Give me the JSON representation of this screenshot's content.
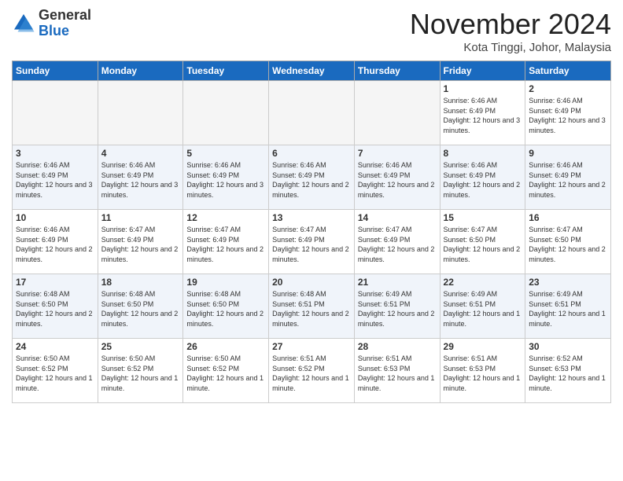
{
  "logo": {
    "general": "General",
    "blue": "Blue"
  },
  "header": {
    "month": "November 2024",
    "location": "Kota Tinggi, Johor, Malaysia"
  },
  "days_of_week": [
    "Sunday",
    "Monday",
    "Tuesday",
    "Wednesday",
    "Thursday",
    "Friday",
    "Saturday"
  ],
  "weeks": [
    [
      {
        "day": null
      },
      {
        "day": null
      },
      {
        "day": null
      },
      {
        "day": null
      },
      {
        "day": null
      },
      {
        "day": "1",
        "sunrise": "6:46 AM",
        "sunset": "6:49 PM",
        "daylight": "12 hours and 3 minutes."
      },
      {
        "day": "2",
        "sunrise": "6:46 AM",
        "sunset": "6:49 PM",
        "daylight": "12 hours and 3 minutes."
      }
    ],
    [
      {
        "day": "3",
        "sunrise": "6:46 AM",
        "sunset": "6:49 PM",
        "daylight": "12 hours and 3 minutes."
      },
      {
        "day": "4",
        "sunrise": "6:46 AM",
        "sunset": "6:49 PM",
        "daylight": "12 hours and 3 minutes."
      },
      {
        "day": "5",
        "sunrise": "6:46 AM",
        "sunset": "6:49 PM",
        "daylight": "12 hours and 3 minutes."
      },
      {
        "day": "6",
        "sunrise": "6:46 AM",
        "sunset": "6:49 PM",
        "daylight": "12 hours and 2 minutes."
      },
      {
        "day": "7",
        "sunrise": "6:46 AM",
        "sunset": "6:49 PM",
        "daylight": "12 hours and 2 minutes."
      },
      {
        "day": "8",
        "sunrise": "6:46 AM",
        "sunset": "6:49 PM",
        "daylight": "12 hours and 2 minutes."
      },
      {
        "day": "9",
        "sunrise": "6:46 AM",
        "sunset": "6:49 PM",
        "daylight": "12 hours and 2 minutes."
      }
    ],
    [
      {
        "day": "10",
        "sunrise": "6:46 AM",
        "sunset": "6:49 PM",
        "daylight": "12 hours and 2 minutes."
      },
      {
        "day": "11",
        "sunrise": "6:47 AM",
        "sunset": "6:49 PM",
        "daylight": "12 hours and 2 minutes."
      },
      {
        "day": "12",
        "sunrise": "6:47 AM",
        "sunset": "6:49 PM",
        "daylight": "12 hours and 2 minutes."
      },
      {
        "day": "13",
        "sunrise": "6:47 AM",
        "sunset": "6:49 PM",
        "daylight": "12 hours and 2 minutes."
      },
      {
        "day": "14",
        "sunrise": "6:47 AM",
        "sunset": "6:49 PM",
        "daylight": "12 hours and 2 minutes."
      },
      {
        "day": "15",
        "sunrise": "6:47 AM",
        "sunset": "6:50 PM",
        "daylight": "12 hours and 2 minutes."
      },
      {
        "day": "16",
        "sunrise": "6:47 AM",
        "sunset": "6:50 PM",
        "daylight": "12 hours and 2 minutes."
      }
    ],
    [
      {
        "day": "17",
        "sunrise": "6:48 AM",
        "sunset": "6:50 PM",
        "daylight": "12 hours and 2 minutes."
      },
      {
        "day": "18",
        "sunrise": "6:48 AM",
        "sunset": "6:50 PM",
        "daylight": "12 hours and 2 minutes."
      },
      {
        "day": "19",
        "sunrise": "6:48 AM",
        "sunset": "6:50 PM",
        "daylight": "12 hours and 2 minutes."
      },
      {
        "day": "20",
        "sunrise": "6:48 AM",
        "sunset": "6:51 PM",
        "daylight": "12 hours and 2 minutes."
      },
      {
        "day": "21",
        "sunrise": "6:49 AM",
        "sunset": "6:51 PM",
        "daylight": "12 hours and 2 minutes."
      },
      {
        "day": "22",
        "sunrise": "6:49 AM",
        "sunset": "6:51 PM",
        "daylight": "12 hours and 1 minute."
      },
      {
        "day": "23",
        "sunrise": "6:49 AM",
        "sunset": "6:51 PM",
        "daylight": "12 hours and 1 minute."
      }
    ],
    [
      {
        "day": "24",
        "sunrise": "6:50 AM",
        "sunset": "6:52 PM",
        "daylight": "12 hours and 1 minute."
      },
      {
        "day": "25",
        "sunrise": "6:50 AM",
        "sunset": "6:52 PM",
        "daylight": "12 hours and 1 minute."
      },
      {
        "day": "26",
        "sunrise": "6:50 AM",
        "sunset": "6:52 PM",
        "daylight": "12 hours and 1 minute."
      },
      {
        "day": "27",
        "sunrise": "6:51 AM",
        "sunset": "6:52 PM",
        "daylight": "12 hours and 1 minute."
      },
      {
        "day": "28",
        "sunrise": "6:51 AM",
        "sunset": "6:53 PM",
        "daylight": "12 hours and 1 minute."
      },
      {
        "day": "29",
        "sunrise": "6:51 AM",
        "sunset": "6:53 PM",
        "daylight": "12 hours and 1 minute."
      },
      {
        "day": "30",
        "sunrise": "6:52 AM",
        "sunset": "6:53 PM",
        "daylight": "12 hours and 1 minute."
      }
    ]
  ]
}
